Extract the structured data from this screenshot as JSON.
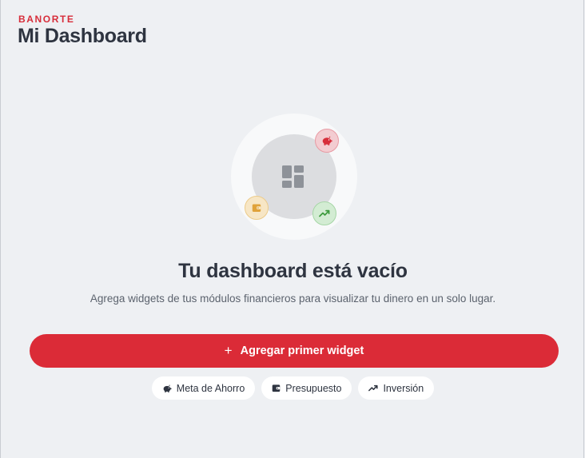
{
  "header": {
    "brand": "BANORTE",
    "title": "Mi Dashboard"
  },
  "empty_state": {
    "title": "Tu dashboard está vacío",
    "subtitle": "Agrega widgets de tus módulos financieros para visualizar tu dinero en un solo lugar."
  },
  "primary_action": {
    "icon": "plus-icon",
    "icon_glyph": "+",
    "label": "Agregar primer widget"
  },
  "chips": [
    {
      "icon": "piggy-bank-icon",
      "label": "Meta de Ahorro"
    },
    {
      "icon": "wallet-icon",
      "label": "Presupuesto"
    },
    {
      "icon": "trending-up-icon",
      "label": "Inversión"
    }
  ],
  "illustration": {
    "center_icon": "dashboard-grid-icon",
    "bubbles": [
      "piggy-bank-icon",
      "wallet-icon",
      "trending-up-icon"
    ]
  },
  "colors": {
    "accent": "#db2b37",
    "brand_text": "#d72d3a",
    "background": "#eef0f3",
    "text_primary": "#2e3440",
    "text_secondary": "#5c636e",
    "savings": "#d72d3a",
    "budget": "#e0a23a",
    "invest": "#3c9a3c"
  }
}
